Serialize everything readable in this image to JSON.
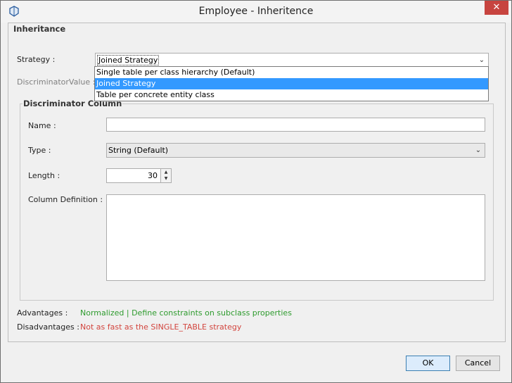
{
  "window": {
    "title": "Employee - Inheritence",
    "close_glyph": "✕"
  },
  "inheritance": {
    "group_title": "Inheritance",
    "strategy_label": "Strategy :",
    "strategy_value": "Joined Strategy",
    "discriminator_value_label": "DiscriminatorValue :",
    "strategy_options": [
      "Single table per class hierarchy (Default)",
      "Joined Strategy",
      "Table per concrete entity class"
    ]
  },
  "discriminator_column": {
    "group_title": "Discriminator Column",
    "name_label": "Name :",
    "name_value": "",
    "type_label": "Type :",
    "type_value": "String (Default)",
    "length_label": "Length :",
    "length_value": "30",
    "column_definition_label": "Column Definition :",
    "column_definition_value": ""
  },
  "advantages": {
    "label": "Advantages :",
    "text": "Normalized | Define constraints on subclass properties",
    "color": "#2e9b2e"
  },
  "disadvantages": {
    "label": "Disadvantages :",
    "text": "Not as fast as the SINGLE_TABLE strategy",
    "color": "#d2453e"
  },
  "buttons": {
    "ok": "OK",
    "cancel": "Cancel"
  },
  "icons": {
    "app": "app-shield-icon",
    "dropdown": "chevron-down-icon",
    "spin_up": "spin-up-icon",
    "spin_down": "spin-down-icon"
  }
}
